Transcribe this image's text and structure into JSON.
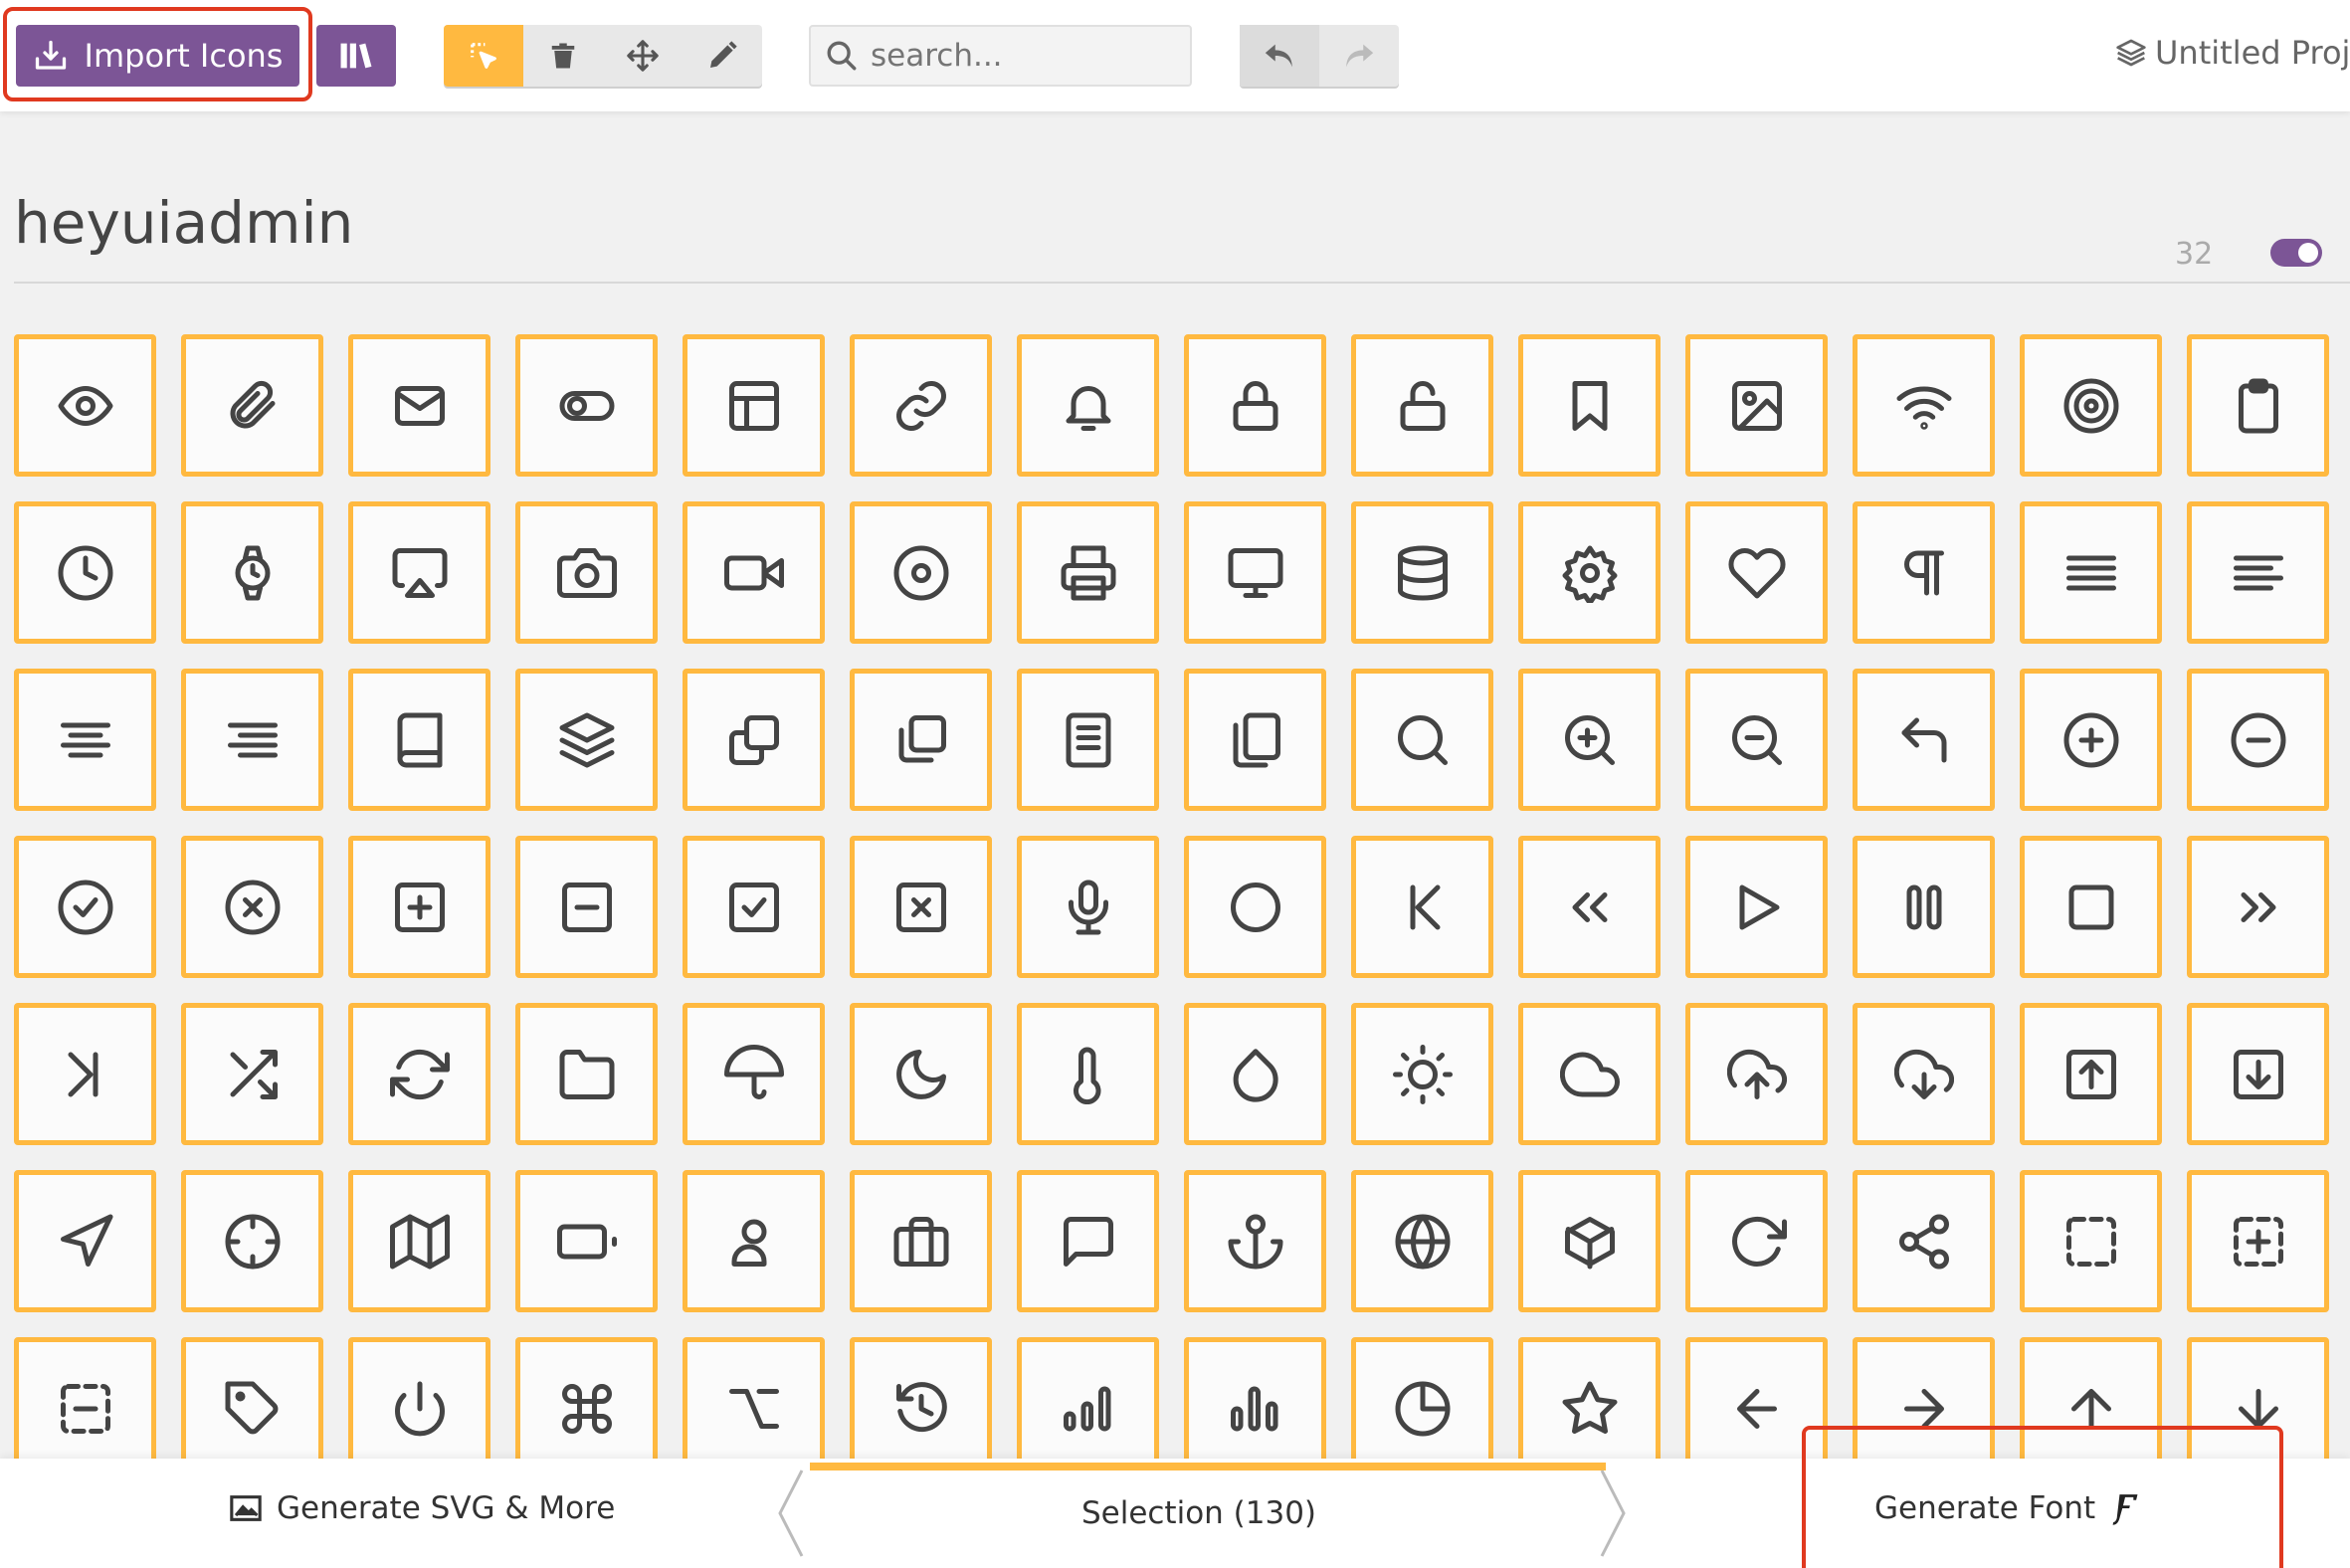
{
  "toolbar": {
    "import_label": "Import Icons",
    "search_placeholder": "search...",
    "project_title": "Untitled Proje"
  },
  "icon_set": {
    "title": "heyuiadmin",
    "count": "32",
    "toggle_on": true
  },
  "footer": {
    "generate_svg_label": "Generate SVG & More",
    "selection_label": "Selection (130)",
    "generate_font_label": "Generate Font"
  },
  "colors": {
    "accent_purple": "#7c5596",
    "selection_orange": "#ffb940",
    "highlight_red": "#e0391f"
  },
  "icons": [
    "eye",
    "paperclip",
    "mail",
    "toggle",
    "layout",
    "link",
    "bell",
    "lock",
    "unlock",
    "bookmark",
    "image",
    "wifi",
    "target",
    "clipboard",
    "clock",
    "watch",
    "airplay",
    "camera",
    "video",
    "disc",
    "printer",
    "monitor",
    "database",
    "settings",
    "heart",
    "paragraph",
    "align-justify",
    "align-left",
    "align-center",
    "align-right",
    "book",
    "layers",
    "copy",
    "copy-2",
    "file-text",
    "files",
    "search",
    "zoom-in",
    "zoom-out",
    "corner-up-left",
    "plus-circle",
    "minus-circle",
    "check-circle",
    "x-circle",
    "plus-square",
    "minus-square",
    "check-square",
    "x-square",
    "mic",
    "circle",
    "skip-back",
    "chevrons-left",
    "play",
    "pause",
    "square",
    "chevrons-right",
    "skip-forward",
    "shuffle",
    "refresh",
    "folder",
    "umbrella",
    "moon",
    "thermometer",
    "droplet",
    "sun",
    "cloud",
    "upload-cloud",
    "download-cloud",
    "upload",
    "download",
    "navigation",
    "crosshair",
    "map",
    "battery",
    "user",
    "briefcase",
    "message-square",
    "anchor",
    "globe",
    "box",
    "rotate-cw",
    "share",
    "dashed-square",
    "dashed-plus",
    "dashed-minus",
    "tag",
    "power",
    "command",
    "option",
    "history",
    "bar-chart",
    "bar-chart-2",
    "pie-chart",
    "star",
    "arrow-left",
    "arrow-right",
    "arrow-up",
    "arrow-down"
  ]
}
